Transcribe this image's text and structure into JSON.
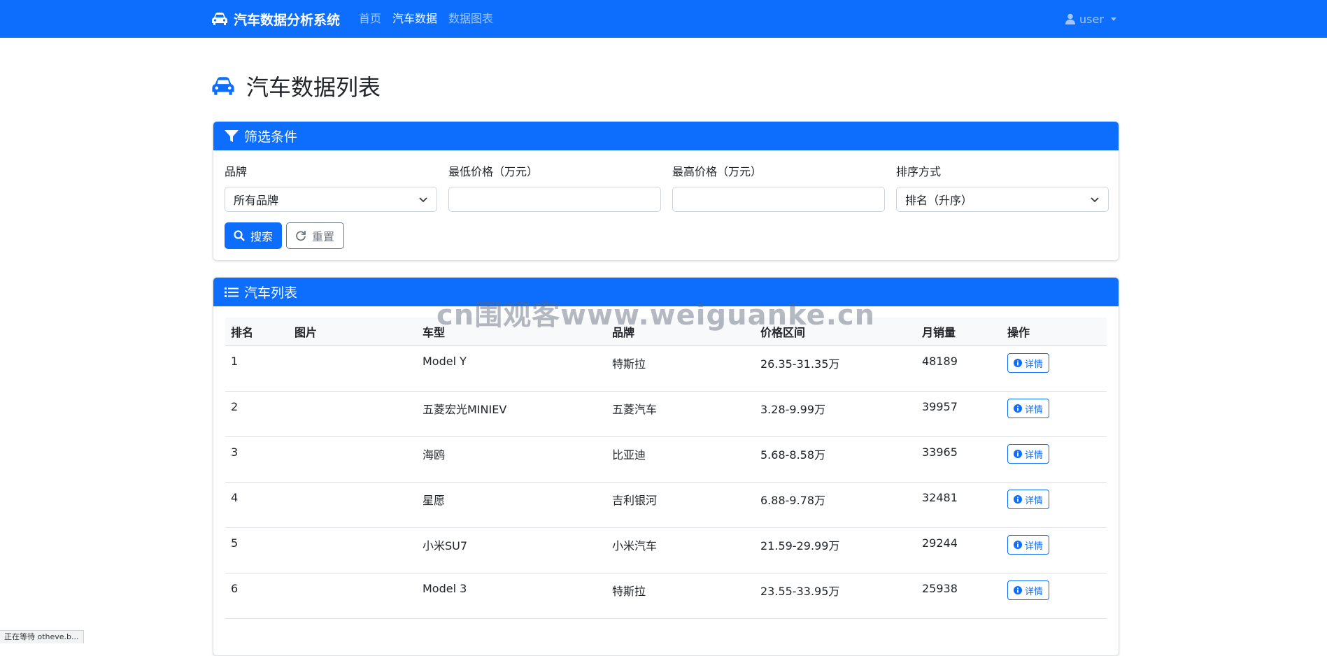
{
  "navbar": {
    "brand": "汽车数据分析系统",
    "links": [
      "首页",
      "汽车数据",
      "数据图表"
    ],
    "active_link": "汽车数据",
    "user": "user",
    "background": "#0d6efd"
  },
  "page": {
    "title": "汽车数据列表",
    "icon": "car-icon"
  },
  "filter": {
    "header": "筛选条件",
    "brand_label": "品牌",
    "brand_value": "所有品牌",
    "min_price_label": "最低价格（万元）",
    "min_price_value": "",
    "max_price_label": "最高价格（万元）",
    "max_price_value": "",
    "sort_label": "排序方式",
    "sort_value": "排名（升序）",
    "search_button": "搜索",
    "reset_button": "重置"
  },
  "list": {
    "header": "汽车列表",
    "columns": [
      "排名",
      "图片",
      "车型",
      "品牌",
      "价格区间",
      "月销量",
      "操作"
    ],
    "detail_label": "详情",
    "rows": [
      {
        "rank": "1",
        "model": "Model Y",
        "brand": "特斯拉",
        "price": "26.35-31.35万",
        "sales": "48189"
      },
      {
        "rank": "2",
        "model": "五菱宏光MINIEV",
        "brand": "五菱汽车",
        "price": "3.28-9.99万",
        "sales": "39957"
      },
      {
        "rank": "3",
        "model": "海鸥",
        "brand": "比亚迪",
        "price": "5.68-8.58万",
        "sales": "33965"
      },
      {
        "rank": "4",
        "model": "星愿",
        "brand": "吉利银河",
        "price": "6.88-9.78万",
        "sales": "32481"
      },
      {
        "rank": "5",
        "model": "小米SU7",
        "brand": "小米汽车",
        "price": "21.59-29.99万",
        "sales": "29244"
      },
      {
        "rank": "6",
        "model": "Model 3",
        "brand": "特斯拉",
        "price": "23.55-33.95万",
        "sales": "25938"
      }
    ]
  },
  "watermark": "cn围观客www.weiguanke.cn",
  "statusbar": "正在等待 otheve.b..."
}
